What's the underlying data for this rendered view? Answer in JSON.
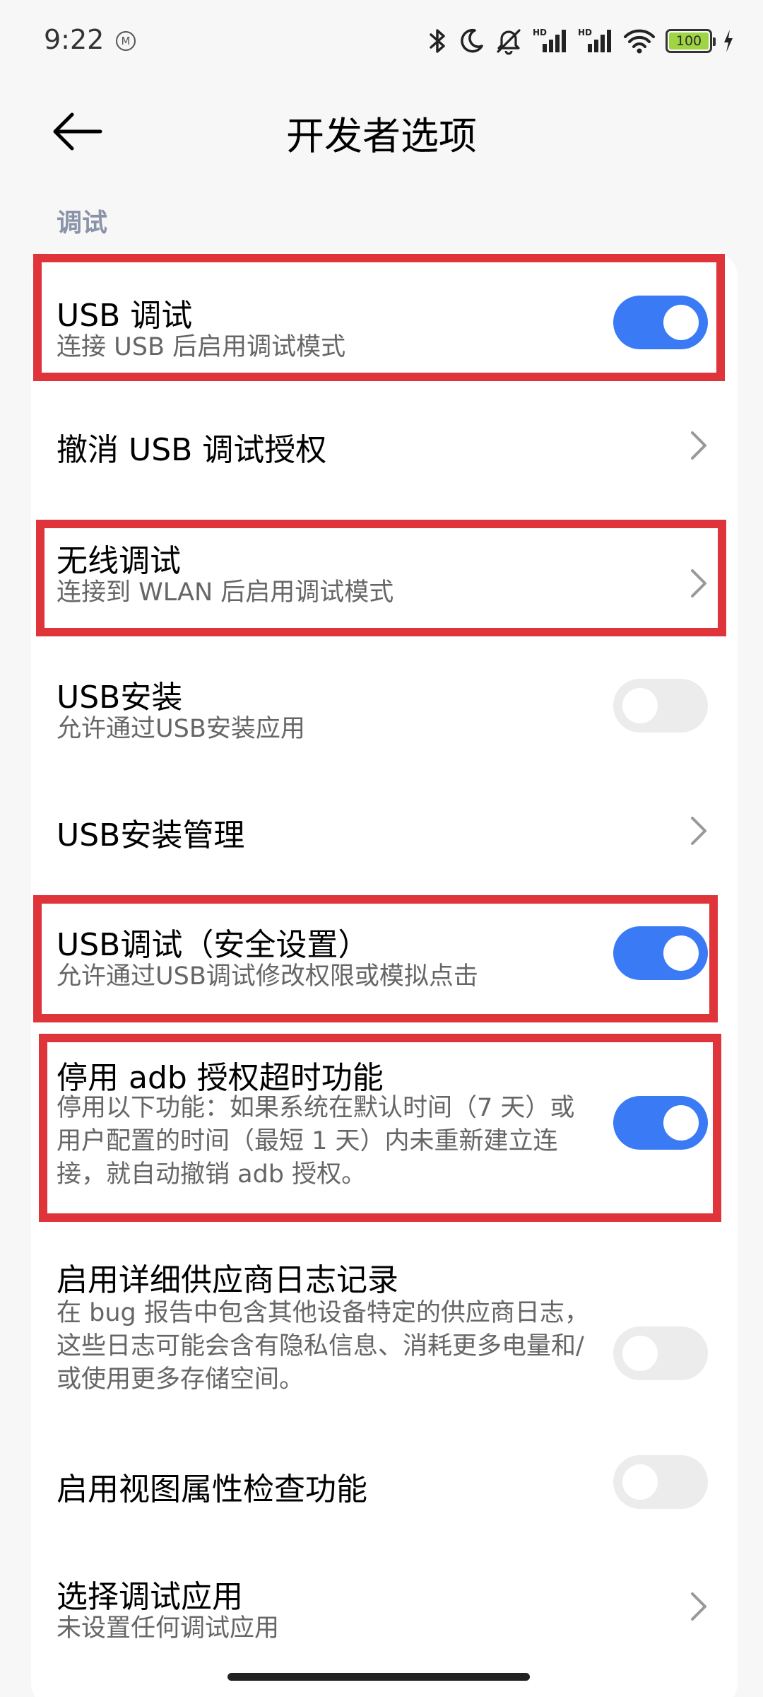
{
  "status_bar": {
    "time": "9:22",
    "notification_badge": "M",
    "battery": "100",
    "icons": [
      "bluetooth-icon",
      "moon-icon",
      "mute-icon",
      "signal-hd-icon",
      "signal-hd-icon",
      "wifi-icon",
      "battery-icon",
      "charging-icon"
    ]
  },
  "header": {
    "title": "开发者选项",
    "back_icon": "arrow-left-icon"
  },
  "section": {
    "label": "调试"
  },
  "items": [
    {
      "title": "USB 调试",
      "subtitle": "连接 USB 后启用调试模式",
      "control": "toggle",
      "on": true,
      "highlighted": true
    },
    {
      "title": "撤消 USB 调试授权",
      "control": "chevron"
    },
    {
      "title": "无线调试",
      "subtitle": "连接到 WLAN 后启用调试模式",
      "control": "chevron",
      "highlighted": true
    },
    {
      "title": "USB安装",
      "subtitle": "允许通过USB安装应用",
      "control": "toggle",
      "on": false
    },
    {
      "title": "USB安装管理",
      "control": "chevron"
    },
    {
      "title": "USB调试（安全设置）",
      "subtitle": "允许通过USB调试修改权限或模拟点击",
      "control": "toggle",
      "on": true,
      "highlighted": true
    },
    {
      "title": "停用 adb 授权超时功能",
      "subtitle": "停用以下功能：如果系统在默认时间（7 天）或用户配置的时间（最短 1 天）内未重新建立连接，就自动撤销 adb 授权。",
      "control": "toggle",
      "on": true,
      "highlighted": true
    },
    {
      "title": "启用详细供应商日志记录",
      "subtitle": "在 bug 报告中包含其他设备特定的供应商日志，这些日志可能会含有隐私信息、消耗更多电量和/或使用更多存储空间。",
      "control": "toggle",
      "on": false
    },
    {
      "title": "启用视图属性检查功能",
      "control": "toggle",
      "on": false
    },
    {
      "title": "选择调试应用",
      "subtitle": "未设置任何调试应用",
      "control": "chevron"
    }
  ],
  "colors": {
    "background": "#f7f7f7",
    "card": "#ffffff",
    "accent": "#3a7af5",
    "highlight": "#e0343b",
    "section_label": "#8a94a8",
    "battery_fill": "#9fd445"
  }
}
